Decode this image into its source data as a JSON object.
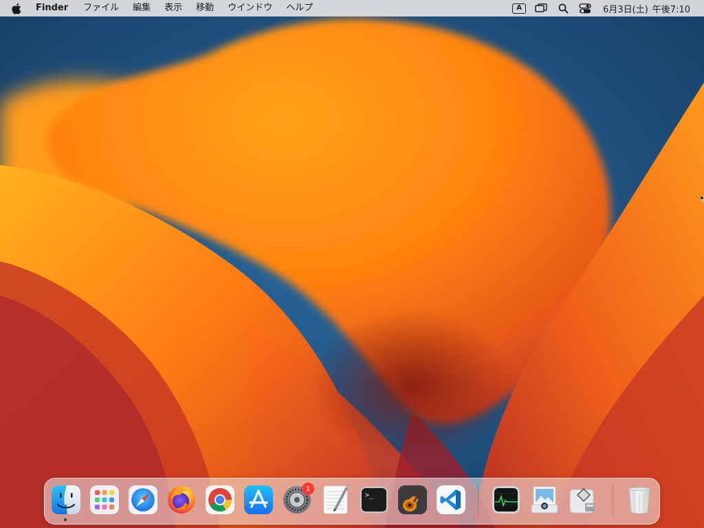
{
  "menubar": {
    "apple_icon": "apple-icon",
    "app_name": "Finder",
    "items": [
      "ファイル",
      "編集",
      "表示",
      "移動",
      "ウインドウ",
      "ヘルプ"
    ],
    "status": {
      "input_source_label": "A",
      "icons": [
        "screen-mirroring-icon",
        "spotlight-search-icon",
        "control-center-icon"
      ],
      "date": "6月3日(土)",
      "time": "午後7:10"
    }
  },
  "dock": {
    "apps": [
      {
        "name": "Finder",
        "icon": "finder-icon",
        "running": true
      },
      {
        "name": "Launchpad",
        "icon": "launchpad-icon"
      },
      {
        "name": "Safari",
        "icon": "safari-icon"
      },
      {
        "name": "Firefox",
        "icon": "firefox-icon"
      },
      {
        "name": "Google Chrome",
        "icon": "chrome-icon"
      },
      {
        "name": "App Store",
        "icon": "app-store-icon"
      },
      {
        "name": "System Settings",
        "icon": "system-settings-icon",
        "badge": "1"
      },
      {
        "name": "TextEdit",
        "icon": "textedit-icon"
      },
      {
        "name": "Terminal",
        "icon": "terminal-icon"
      },
      {
        "name": "GarageBand",
        "icon": "garageband-icon"
      },
      {
        "name": "Visual Studio Code",
        "icon": "vscode-icon"
      }
    ],
    "extras": [
      {
        "name": "Activity Monitor",
        "icon": "activity-monitor-icon"
      },
      {
        "name": "Preview",
        "icon": "preview-icon"
      },
      {
        "name": "Boot Camp Assistant",
        "icon": "boot-camp-icon"
      }
    ],
    "trash": {
      "name": "Trash",
      "icon": "trash-icon"
    }
  },
  "colors": {
    "wallpaper_blue": "#1d4f7e",
    "wallpaper_orange": "#ff8a10",
    "wallpaper_red": "#d8401a",
    "badge_red": "#ff3b30"
  }
}
